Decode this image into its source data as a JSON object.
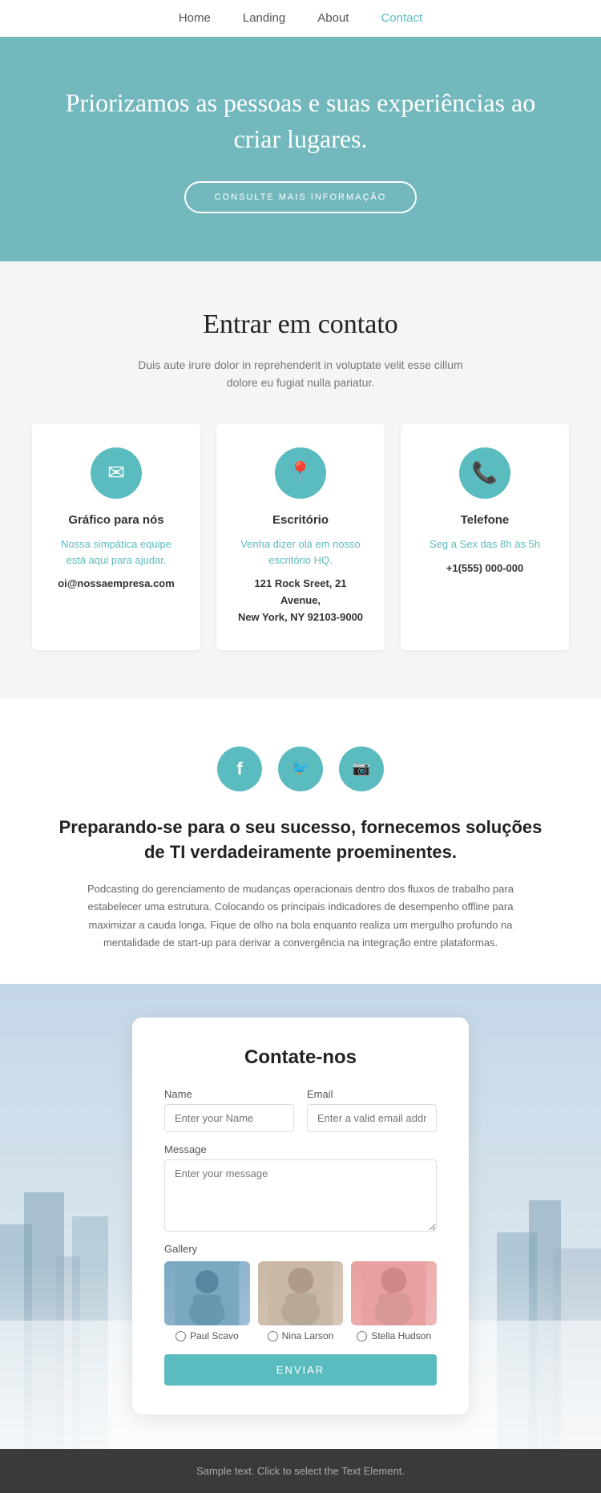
{
  "nav": {
    "items": [
      {
        "label": "Home",
        "active": false
      },
      {
        "label": "Landing",
        "active": false
      },
      {
        "label": "About",
        "active": false
      },
      {
        "label": "Contact",
        "active": true
      }
    ]
  },
  "hero": {
    "title": "Priorizamos as pessoas e suas experiências ao criar lugares.",
    "button_label": "CONSULTE MAIS INFORMAÇÃO"
  },
  "contact_section": {
    "heading": "Entrar em contato",
    "description": "Duis aute irure dolor in reprehenderit in voluptate velit esse cillum dolore eu fugiat nulla pariatur.",
    "cards": [
      {
        "icon": "✉",
        "title": "Gráfico para nós",
        "link_text": "Nossa simpática equipe está aqui para ajudar.",
        "detail": "oi@nossaempresa.com"
      },
      {
        "icon": "📍",
        "title": "Escritório",
        "link_text": "Venha dizer olá em nosso escritório HQ.",
        "detail": "121 Rock Sreet, 21 Avenue,\nNew York, NY 92103-9000"
      },
      {
        "icon": "📞",
        "title": "Telefone",
        "link_text": "Seg a Sex das 8h às 5h",
        "detail": "+1(555) 000-000"
      }
    ]
  },
  "social": {
    "icons": [
      "f",
      "t",
      "i"
    ],
    "heading": "Preparando-se para o seu sucesso, fornecemos soluções de TI verdadeiramente proeminentes.",
    "description": "Podcasting do gerenciamento de mudanças operacionais dentro dos fluxos de trabalho para estabelecer uma estrutura. Colocando os principais indicadores de desempenho offline para maximizar a cauda longa. Fique de olho na bola enquanto realiza um mergulho profundo na mentalidade de start-up para derivar a convergência na integração entre plataformas."
  },
  "form": {
    "heading": "Contate-nos",
    "name_label": "Name",
    "name_placeholder": "Enter your Name",
    "email_label": "Email",
    "email_placeholder": "Enter a valid email address",
    "message_label": "Message",
    "message_placeholder": "Enter your message",
    "gallery_label": "Gallery",
    "gallery_items": [
      {
        "name": "Paul Scavo"
      },
      {
        "name": "Nina Larson"
      },
      {
        "name": "Stella Hudson"
      }
    ],
    "submit_label": "ENVIAR"
  },
  "footer": {
    "text": "Sample text. Click to select the Text Element."
  }
}
